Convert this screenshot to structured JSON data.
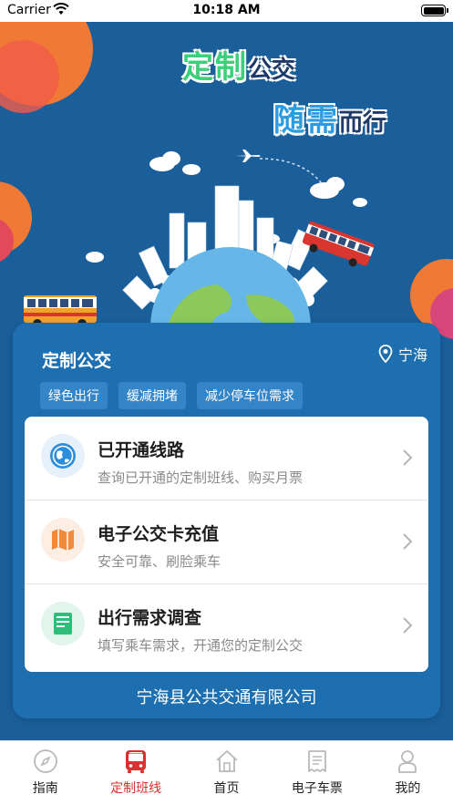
{
  "status_bar": {
    "carrier": "Carrier",
    "time": "10:18 AM"
  },
  "hero": {
    "slogan_line1_big": "定制",
    "slogan_line1_small": "公交",
    "slogan_line2_big": "随需",
    "slogan_line2_small": "而行"
  },
  "card": {
    "title": "定制公交",
    "location": "宁海",
    "tags": [
      "绿色出行",
      "缓减拥堵",
      "减少停车位需求"
    ],
    "menu": [
      {
        "title": "已开通线路",
        "desc": "查询已开通的定制班线、购买月票",
        "icon": "globe-icon"
      },
      {
        "title": "电子公交卡充值",
        "desc": "安全可靠、刷脸乘车",
        "icon": "map-icon"
      },
      {
        "title": "出行需求调查",
        "desc": "填写乘车需求，开通您的定制公交",
        "icon": "survey-icon"
      }
    ],
    "company": "宁海县公共交通有限公司"
  },
  "tabbar": {
    "items": [
      {
        "label": "指南",
        "icon": "compass-icon",
        "active": false
      },
      {
        "label": "定制班线",
        "icon": "bus-icon",
        "active": true
      },
      {
        "label": "首页",
        "icon": "home-icon",
        "active": false
      },
      {
        "label": "电子车票",
        "icon": "ticket-icon",
        "active": false
      },
      {
        "label": "我的",
        "icon": "user-icon",
        "active": false
      }
    ]
  },
  "colors": {
    "hero_bg": "#1a5e9a",
    "card_bg": "#1e6fb0",
    "tag_bg": "#3485c8",
    "accent_red": "#d9312f",
    "slogan_green": "#3bd07a",
    "slogan_blue": "#2c9be0"
  }
}
